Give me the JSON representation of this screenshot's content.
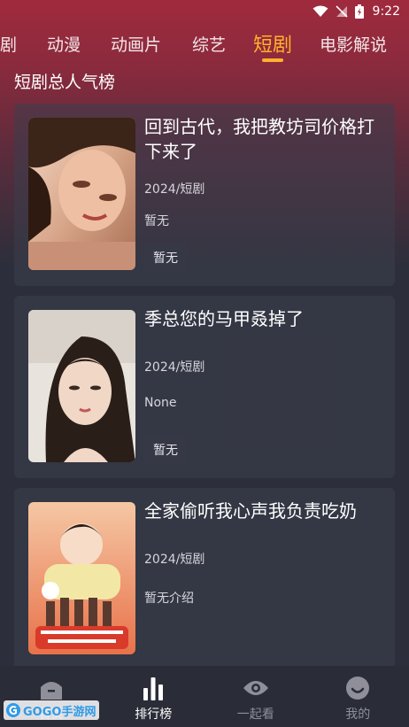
{
  "status_bar": {
    "time": "9:22"
  },
  "tabs": [
    {
      "label": "剧",
      "active": false
    },
    {
      "label": "动漫",
      "active": false
    },
    {
      "label": "动画片",
      "active": false
    },
    {
      "label": "综艺",
      "active": false
    },
    {
      "label": "短剧",
      "active": true
    },
    {
      "label": "电影解说",
      "active": false
    }
  ],
  "section": {
    "title": "短剧总人气榜"
  },
  "cards": [
    {
      "title": "回到古代，我把教坊司价格打下来了",
      "meta": "2024/短剧",
      "desc": "暂无",
      "tag": "暂无"
    },
    {
      "title": "季总您的马甲叒掉了",
      "meta": "2024/短剧",
      "desc": "None",
      "tag": "暂无"
    },
    {
      "title": "全家偷听我心声我负责吃奶",
      "meta": "2024/短剧",
      "desc": "暂无介绍",
      "tag": ""
    }
  ],
  "bottom_nav": [
    {
      "label": "首页",
      "icon": "home-icon",
      "active": false
    },
    {
      "label": "排行榜",
      "icon": "chart-icon",
      "active": true
    },
    {
      "label": "一起看",
      "icon": "eye-icon",
      "active": false
    },
    {
      "label": "我的",
      "icon": "profile-icon",
      "active": false
    }
  ],
  "watermark": {
    "text": "GOGO手游网"
  },
  "colors": {
    "accent": "#ffb12e",
    "header_top": "#a02a3d",
    "background": "#2c2f3b"
  }
}
